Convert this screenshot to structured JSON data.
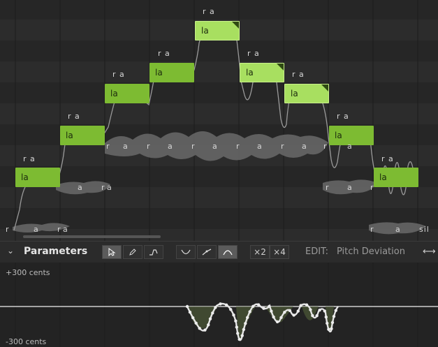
{
  "notes": [
    {
      "lyric": "la",
      "phoneme": "r a"
    },
    {
      "lyric": "la",
      "phoneme": "r a"
    },
    {
      "lyric": "la",
      "phoneme": "r a"
    },
    {
      "lyric": "la",
      "phoneme": "r a"
    },
    {
      "lyric": "la",
      "phoneme": "r a"
    },
    {
      "lyric": "la",
      "phoneme": "r a"
    },
    {
      "lyric": "la",
      "phoneme": "r a"
    },
    {
      "lyric": "la",
      "phoneme": "r a"
    },
    {
      "lyric": "la",
      "phoneme": "r a"
    }
  ],
  "phoneme_tracks": {
    "bottom": [
      "r",
      "a",
      "r",
      "a"
    ],
    "second": [
      "a",
      "r",
      "a"
    ],
    "middle": [
      "r",
      "a",
      "r",
      "a",
      "r",
      "a",
      "r",
      "a",
      "r",
      "a",
      "r",
      "a"
    ],
    "right_low": [
      "r",
      "a",
      "r"
    ],
    "right_bottom": [
      "r",
      "a",
      "sil"
    ]
  },
  "parameters": {
    "title": "Parameters",
    "chevron": "⌄",
    "x2_label": "×2",
    "x4_label": "×4",
    "edit_label": "EDIT:",
    "edit_value": "Pitch Deviation",
    "swap_icon": "⟷",
    "top_label": "+300 cents",
    "bottom_label": "-300 cents"
  },
  "colors": {
    "note_green": "#7dbb32",
    "note_selected": "#a8df60",
    "background": "#242424"
  }
}
